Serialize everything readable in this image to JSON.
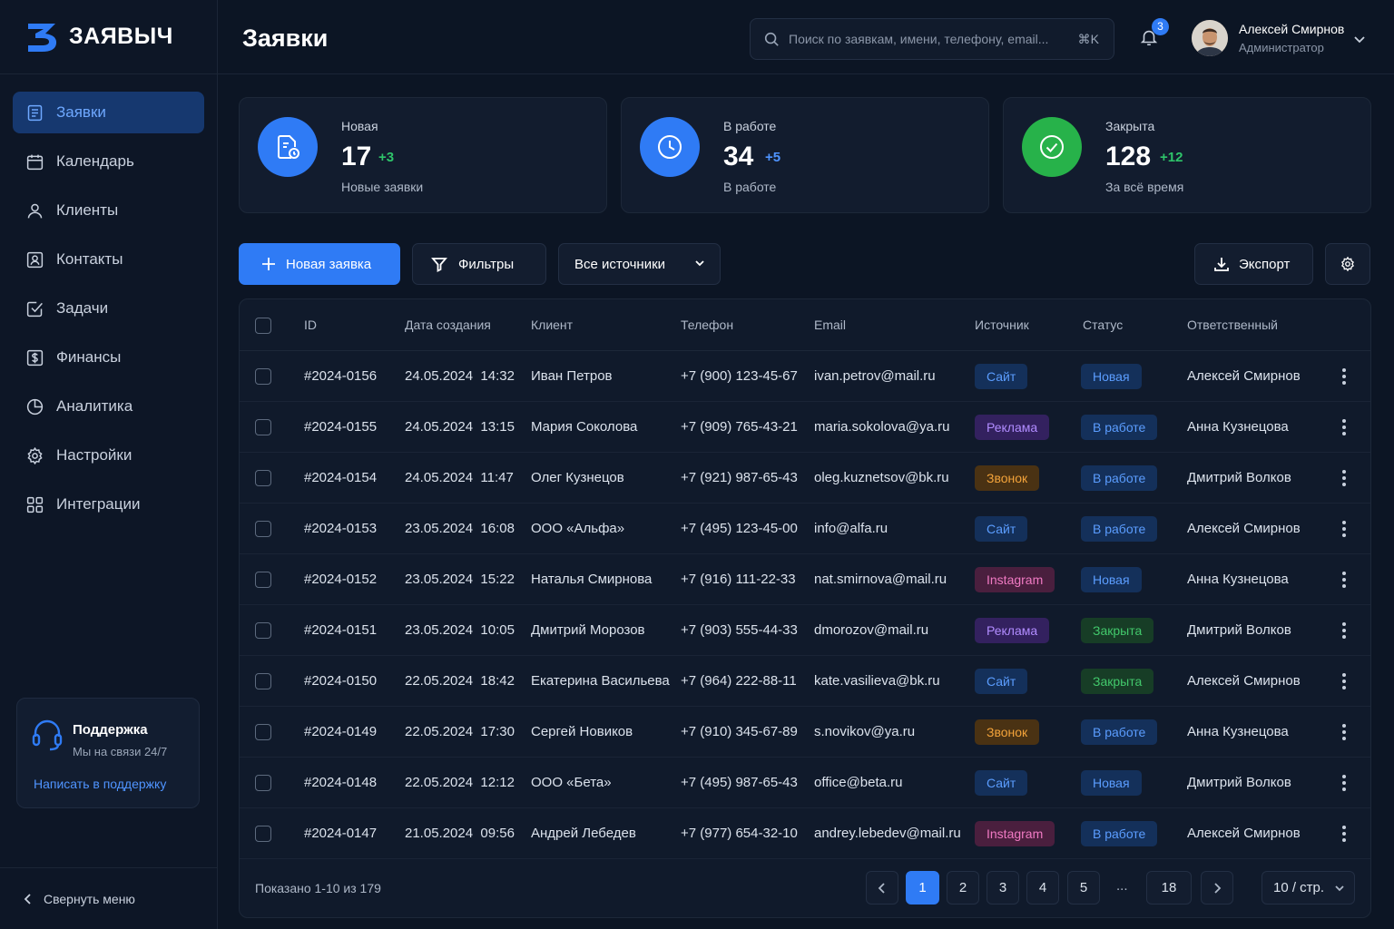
{
  "brand": {
    "name": "ЗАЯВЫЧ",
    "accent": "#2f7bf5"
  },
  "sidebar": {
    "items": [
      {
        "label": "Заявки",
        "icon": "document-icon",
        "active": true
      },
      {
        "label": "Календарь",
        "icon": "calendar-icon"
      },
      {
        "label": "Клиенты",
        "icon": "user-icon"
      },
      {
        "label": "Контакты",
        "icon": "contact-card-icon"
      },
      {
        "label": "Задачи",
        "icon": "checkbox-icon"
      },
      {
        "label": "Финансы",
        "icon": "dollar-icon"
      },
      {
        "label": "Аналитика",
        "icon": "pie-chart-icon"
      },
      {
        "label": "Настройки",
        "icon": "gear-icon"
      },
      {
        "label": "Интеграции",
        "icon": "grid-icon"
      }
    ],
    "support": {
      "title": "Поддержка",
      "subtitle": "Мы на связи 24/7",
      "link": "Написать в поддержку"
    },
    "collapse": "Свернуть меню"
  },
  "header": {
    "title": "Заявки",
    "search_placeholder": "Поиск по заявкам, имени, телефону, email...",
    "shortcut": "⌘K",
    "notifications": "3",
    "user": {
      "name": "Алексей Смирнов",
      "role": "Администратор"
    }
  },
  "stats": [
    {
      "label": "Новая",
      "value": "17",
      "delta": "+3",
      "sub": "Новые заявки",
      "color": "#2f7bf5",
      "delta_color": "#2ec46a",
      "icon": "document-clock-icon"
    },
    {
      "label": "В работе",
      "value": "34",
      "delta": "+5",
      "sub": "В работе",
      "color": "#2f7bf5",
      "delta_color": "#4f94ff",
      "icon": "clock-icon"
    },
    {
      "label": "Закрыта",
      "value": "128",
      "delta": "+12",
      "sub": "За всё время",
      "color": "#27b24a",
      "delta_color": "#2ec46a",
      "icon": "check-circle-icon"
    }
  ],
  "toolbar": {
    "new_label": "Новая заявка",
    "filters_label": "Фильтры",
    "source_select": "Все источники",
    "export_label": "Экспорт"
  },
  "table": {
    "columns": [
      "ID",
      "Дата создания",
      "Клиент",
      "Телефон",
      "Email",
      "Источник",
      "Статус",
      "Ответственный"
    ],
    "rows": [
      {
        "id": "#2024-0156",
        "date": "24.05.2024  14:32",
        "client": "Иван Петров",
        "phone": "+7 (900) 123-45-67",
        "email": "ivan.petrov@mail.ru",
        "source": "Сайт",
        "status": "Новая",
        "owner": "Алексей Смирнов"
      },
      {
        "id": "#2024-0155",
        "date": "24.05.2024  13:15",
        "client": "Мария Соколова",
        "phone": "+7 (909) 765-43-21",
        "email": "maria.sokolova@ya.ru",
        "source": "Реклама",
        "status": "В работе",
        "owner": "Анна Кузнецова"
      },
      {
        "id": "#2024-0154",
        "date": "24.05.2024  11:47",
        "client": "Олег Кузнецов",
        "phone": "+7 (921) 987-65-43",
        "email": "oleg.kuznetsov@bk.ru",
        "source": "Звонок",
        "status": "В работе",
        "owner": "Дмитрий Волков"
      },
      {
        "id": "#2024-0153",
        "date": "23.05.2024  16:08",
        "client": "ООО «Альфа»",
        "phone": "+7 (495) 123-45-00",
        "email": "info@alfa.ru",
        "source": "Сайт",
        "status": "В работе",
        "owner": "Алексей Смирнов"
      },
      {
        "id": "#2024-0152",
        "date": "23.05.2024  15:22",
        "client": "Наталья Смирнова",
        "phone": "+7 (916) 111-22-33",
        "email": "nat.smirnova@mail.ru",
        "source": "Instagram",
        "status": "Новая",
        "owner": "Анна Кузнецова"
      },
      {
        "id": "#2024-0151",
        "date": "23.05.2024  10:05",
        "client": "Дмитрий Морозов",
        "phone": "+7 (903) 555-44-33",
        "email": "dmorozov@mail.ru",
        "source": "Реклама",
        "status": "Закрыта",
        "owner": "Дмитрий Волков"
      },
      {
        "id": "#2024-0150",
        "date": "22.05.2024  18:42",
        "client": "Екатерина Васильева",
        "phone": "+7 (964) 222-88-11",
        "email": "kate.vasilieva@bk.ru",
        "source": "Сайт",
        "status": "Закрыта",
        "owner": "Алексей Смирнов"
      },
      {
        "id": "#2024-0149",
        "date": "22.05.2024  17:30",
        "client": "Сергей Новиков",
        "phone": "+7 (910) 345-67-89",
        "email": "s.novikov@ya.ru",
        "source": "Звонок",
        "status": "В работе",
        "owner": "Анна Кузнецова"
      },
      {
        "id": "#2024-0148",
        "date": "22.05.2024  12:12",
        "client": "ООО «Бета»",
        "phone": "+7 (495) 987-65-43",
        "email": "office@beta.ru",
        "source": "Сайт",
        "status": "Новая",
        "owner": "Дмитрий Волков"
      },
      {
        "id": "#2024-0147",
        "date": "21.05.2024  09:56",
        "client": "Андрей Лебедев",
        "phone": "+7 (977) 654-32-10",
        "email": "andrey.lebedev@mail.ru",
        "source": "Instagram",
        "status": "В работе",
        "owner": "Алексей Смирнов"
      }
    ],
    "source_colors": {
      "Сайт": {
        "bg": "#14305a",
        "fg": "#5b9dff"
      },
      "Реклама": {
        "bg": "#33215f",
        "fg": "#b18cff"
      },
      "Звонок": {
        "bg": "#4a3213",
        "fg": "#f3a33a"
      },
      "Instagram": {
        "bg": "#4a1f3e",
        "fg": "#f07ac3"
      }
    },
    "status_colors": {
      "Новая": {
        "bg": "#14305a",
        "fg": "#5b9dff"
      },
      "В работе": {
        "bg": "#14305a",
        "fg": "#5b9dff"
      },
      "Закрыта": {
        "bg": "#173d26",
        "fg": "#42c86b"
      }
    },
    "footer": "Показано 1-10 из 179",
    "pages": [
      "1",
      "2",
      "3",
      "4",
      "5"
    ],
    "ellipsis": "...",
    "last_page": "18",
    "page_size": "10 / стр."
  }
}
